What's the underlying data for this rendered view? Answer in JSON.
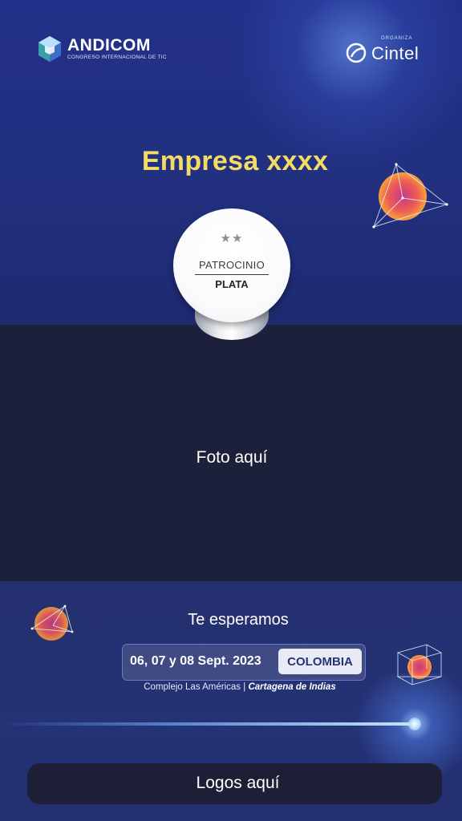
{
  "header": {
    "andicom_name": "ANDICOM",
    "andicom_subtitle": "CONGRESO INTERNACIONAL DE TIC",
    "cintel_label": "ORGANIZA",
    "cintel_name": "Cintel"
  },
  "company": {
    "title": "Empresa xxxx"
  },
  "badge": {
    "stars": "★★",
    "line1": "PATROCINIO",
    "line2": "PLATA"
  },
  "photo": {
    "placeholder": "Foto aquí"
  },
  "event": {
    "tagline": "Te esperamos",
    "dates": "06, 07 y 08 Sept. 2023",
    "country": "COLOMBIA",
    "venue": "Complejo Las Américas | ",
    "city": "Cartagena de Indias"
  },
  "footer": {
    "logos_placeholder": "Logos aquí"
  },
  "colors": {
    "background": "#243078",
    "title_yellow": "#f4dc64",
    "photo_area": "#1d203a",
    "logos_bar": "#1c1f36"
  },
  "icons": [
    "andicom-cube-icon",
    "cintel-logo-icon",
    "star-icon",
    "gradient-polyhedron-icon"
  ]
}
